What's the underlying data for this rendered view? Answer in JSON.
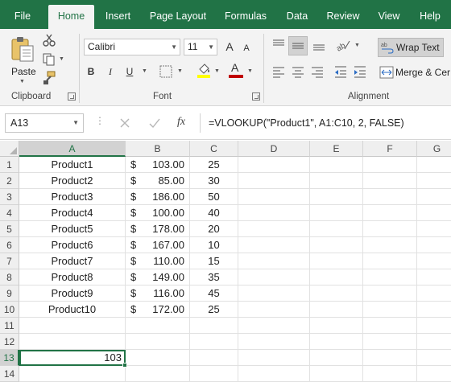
{
  "tabs": [
    "File",
    "Home",
    "Insert",
    "Page Layout",
    "Formulas",
    "Data",
    "Review",
    "View",
    "Help"
  ],
  "active_tab": "Home",
  "ribbon": {
    "clipboard": {
      "paste_label": "Paste",
      "group_label": "Clipboard"
    },
    "font": {
      "font_name": "Calibri",
      "font_size": "11",
      "bold": "B",
      "italic": "I",
      "underline": "U",
      "grow": "A",
      "shrink": "A",
      "group_label": "Font"
    },
    "alignment": {
      "wrap_text": "Wrap Text",
      "merge_center": "Merge & Cer",
      "group_label": "Alignment"
    },
    "colors": {
      "fill": "#ffff00",
      "font": "#c00000",
      "accent": "#217346"
    }
  },
  "formula_bar": {
    "name_box": "A13",
    "fx": "fx",
    "formula": "=VLOOKUP(\"Product1\", A1:C10, 2, FALSE)"
  },
  "grid": {
    "columns": [
      "A",
      "B",
      "C",
      "D",
      "E",
      "F",
      "G"
    ],
    "rows": [
      "1",
      "2",
      "3",
      "4",
      "5",
      "6",
      "7",
      "8",
      "9",
      "10",
      "11",
      "12",
      "13",
      "14"
    ],
    "data": [
      {
        "a": "Product1",
        "cur": "$",
        "b": "103.00",
        "c": "25"
      },
      {
        "a": "Product2",
        "cur": "$",
        "b": "85.00",
        "c": "30"
      },
      {
        "a": "Product3",
        "cur": "$",
        "b": "186.00",
        "c": "50"
      },
      {
        "a": "Product4",
        "cur": "$",
        "b": "100.00",
        "c": "40"
      },
      {
        "a": "Product5",
        "cur": "$",
        "b": "178.00",
        "c": "20"
      },
      {
        "a": "Product6",
        "cur": "$",
        "b": "167.00",
        "c": "10"
      },
      {
        "a": "Product7",
        "cur": "$",
        "b": "110.00",
        "c": "15"
      },
      {
        "a": "Product8",
        "cur": "$",
        "b": "149.00",
        "c": "35"
      },
      {
        "a": "Product9",
        "cur": "$",
        "b": "116.00",
        "c": "45"
      },
      {
        "a": "Product10",
        "cur": "$",
        "b": "172.00",
        "c": "25"
      }
    ],
    "a13_value": "103"
  }
}
